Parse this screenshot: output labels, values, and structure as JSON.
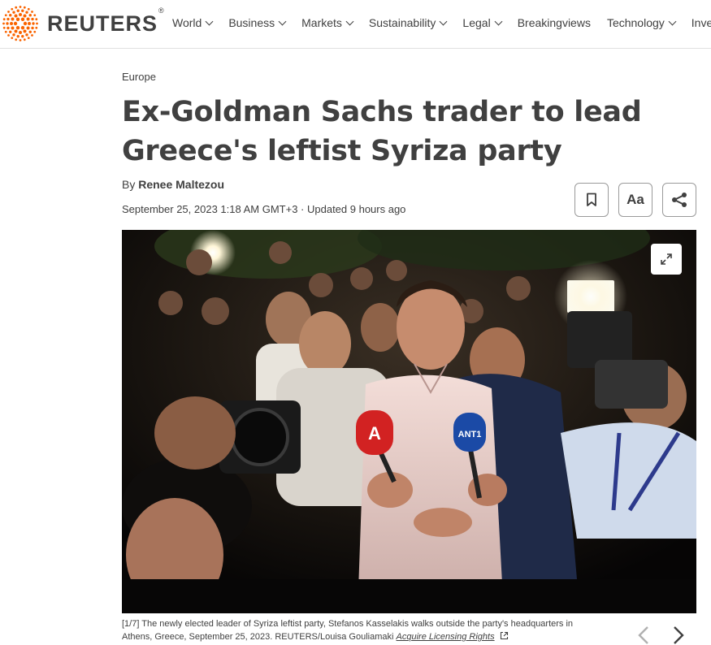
{
  "brand": {
    "name": "REUTERS",
    "mark": "®"
  },
  "nav": {
    "items": [
      {
        "label": "World"
      },
      {
        "label": "Business"
      },
      {
        "label": "Markets"
      },
      {
        "label": "Sustainability"
      },
      {
        "label": "Legal"
      },
      {
        "label": "Breakingviews"
      },
      {
        "label": "Technology"
      },
      {
        "label": "Inves"
      }
    ]
  },
  "article": {
    "section": "Europe",
    "headline_line1": "Ex-Goldman Sachs trader to lead",
    "headline_line2": "Greece's leftist Syriza party",
    "byline_prefix": "By",
    "author": "Renee Maltezou",
    "date": "September 25, 2023 1:18 AM GMT+3",
    "updated": " · Updated 9 hours ago"
  },
  "actions": {
    "font_label": "Aa"
  },
  "photo": {
    "counter": "[1/7]",
    "caption": " The newly elected leader of Syriza leftist party, Stefanos Kasselakis walks outside the party's headquarters in Athens, Greece, September 25, 2023. REUTERS/Louisa Gouliamaki ",
    "licensing": "Acquire Licensing Rights",
    "mic_left_logo": "A",
    "mic_right_logo": "ANT1"
  },
  "colors": {
    "accent": "#fa6400",
    "text": "#404040",
    "border": "#9a9a9a"
  }
}
